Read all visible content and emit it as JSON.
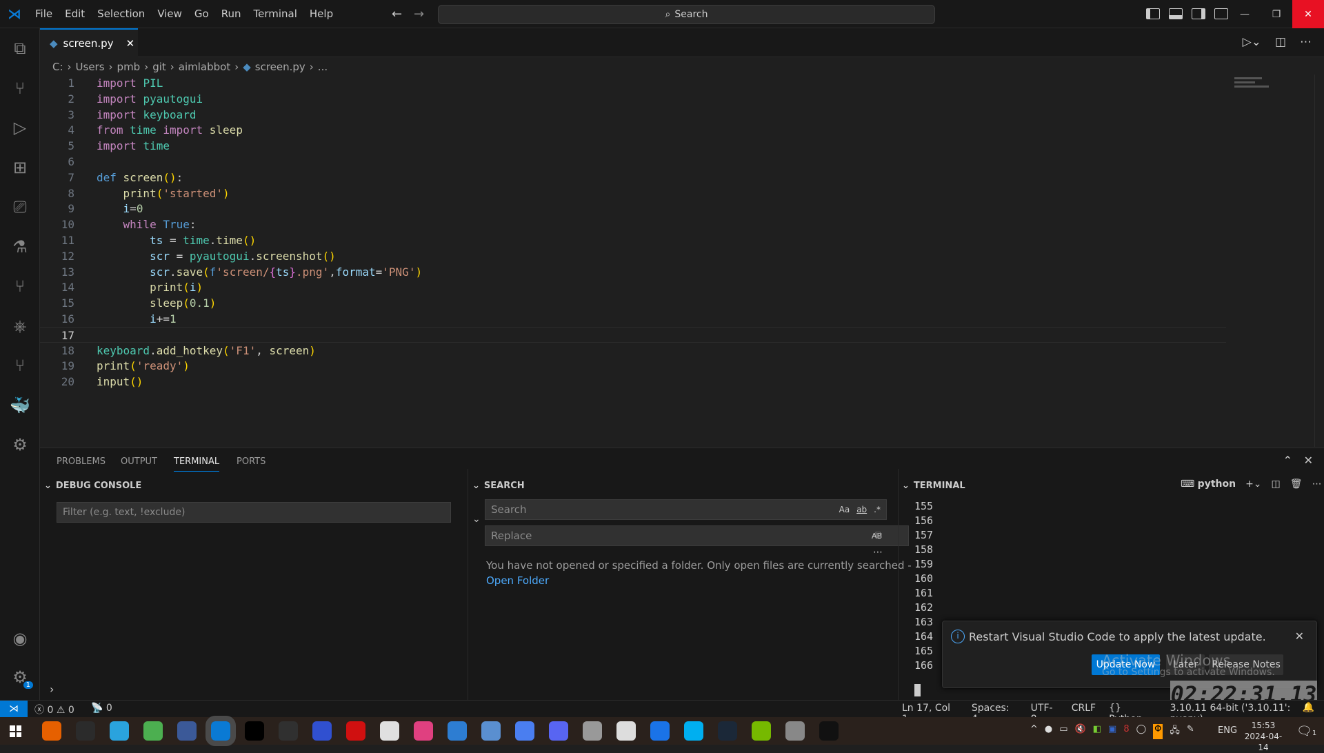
{
  "titlebar": {
    "menu": [
      "File",
      "Edit",
      "Selection",
      "View",
      "Go",
      "Run",
      "Terminal",
      "Help"
    ],
    "search_label": "Search",
    "close_color": "#e81123"
  },
  "activity_bar": [
    "files-icon",
    "source-control-icon",
    "run-debug-icon",
    "extensions-icon",
    "remote-explorer-icon",
    "testing-icon",
    "git-graph-icon",
    "kubernetes-icon",
    "gitlens-icon",
    "docker-icon",
    "python-env-icon"
  ],
  "activity_bottom": {
    "accounts": "accounts-icon",
    "manage": "gear-icon",
    "badge": "1"
  },
  "tab": {
    "label": "screen.py"
  },
  "breadcrumb": [
    "C:",
    "Users",
    "pmb",
    "git",
    "aimlabbot",
    "screen.py",
    "..."
  ],
  "editor": {
    "current_line": 17,
    "lines": [
      [
        [
          "import",
          "k"
        ],
        [
          " ",
          "t"
        ],
        [
          "PIL",
          "m"
        ]
      ],
      [
        [
          "import",
          "k"
        ],
        [
          " ",
          "t"
        ],
        [
          "pyautogui",
          "m"
        ]
      ],
      [
        [
          "import",
          "k"
        ],
        [
          " ",
          "t"
        ],
        [
          "keyboard",
          "m"
        ]
      ],
      [
        [
          "from",
          "k"
        ],
        [
          " ",
          "t"
        ],
        [
          "time",
          "m"
        ],
        [
          " ",
          "t"
        ],
        [
          "import",
          "k"
        ],
        [
          " ",
          "t"
        ],
        [
          "sleep",
          "f"
        ]
      ],
      [
        [
          "import",
          "k"
        ],
        [
          " ",
          "t"
        ],
        [
          "time",
          "m"
        ]
      ],
      [],
      [
        [
          "def",
          "d"
        ],
        [
          " ",
          "t"
        ],
        [
          "screen",
          "f"
        ],
        [
          "()",
          "b"
        ],
        [
          ":",
          "t"
        ]
      ],
      [
        [
          "    ",
          "t"
        ],
        [
          "print",
          "f"
        ],
        [
          "(",
          "b"
        ],
        [
          "'started'",
          "s"
        ],
        [
          ")",
          "b"
        ]
      ],
      [
        [
          "    ",
          "t"
        ],
        [
          "i",
          "v"
        ],
        [
          "=",
          "t"
        ],
        [
          "0",
          "n"
        ]
      ],
      [
        [
          "    ",
          "t"
        ],
        [
          "while",
          "k"
        ],
        [
          " ",
          "t"
        ],
        [
          "True",
          "d"
        ],
        [
          ":",
          "t"
        ]
      ],
      [
        [
          "        ",
          "t"
        ],
        [
          "ts",
          "v"
        ],
        [
          " = ",
          "t"
        ],
        [
          "time",
          "m"
        ],
        [
          ".",
          "t"
        ],
        [
          "time",
          "f"
        ],
        [
          "()",
          "b"
        ]
      ],
      [
        [
          "        ",
          "t"
        ],
        [
          "scr",
          "v"
        ],
        [
          " = ",
          "t"
        ],
        [
          "pyautogui",
          "m"
        ],
        [
          ".",
          "t"
        ],
        [
          "screenshot",
          "f"
        ],
        [
          "()",
          "b"
        ]
      ],
      [
        [
          "        ",
          "t"
        ],
        [
          "scr",
          "v"
        ],
        [
          ".",
          "t"
        ],
        [
          "save",
          "f"
        ],
        [
          "(",
          "b"
        ],
        [
          "f",
          "d"
        ],
        [
          "'screen/",
          "s"
        ],
        [
          "{",
          "p"
        ],
        [
          "ts",
          "v"
        ],
        [
          "}",
          "p"
        ],
        [
          ".png'",
          "s"
        ],
        [
          ",",
          "t"
        ],
        [
          "format",
          "v"
        ],
        [
          "=",
          "t"
        ],
        [
          "'PNG'",
          "s"
        ],
        [
          ")",
          "b"
        ]
      ],
      [
        [
          "        ",
          "t"
        ],
        [
          "print",
          "f"
        ],
        [
          "(",
          "b"
        ],
        [
          "i",
          "v"
        ],
        [
          ")",
          "b"
        ]
      ],
      [
        [
          "        ",
          "t"
        ],
        [
          "sleep",
          "f"
        ],
        [
          "(",
          "b"
        ],
        [
          "0.1",
          "n"
        ],
        [
          ")",
          "b"
        ]
      ],
      [
        [
          "        ",
          "t"
        ],
        [
          "i",
          "v"
        ],
        [
          "+=",
          "t"
        ],
        [
          "1",
          "n"
        ]
      ],
      [],
      [
        [
          "keyboard",
          "m"
        ],
        [
          ".",
          "t"
        ],
        [
          "add_hotkey",
          "f"
        ],
        [
          "(",
          "b"
        ],
        [
          "'F1'",
          "s"
        ],
        [
          ", ",
          "t"
        ],
        [
          "screen",
          "f"
        ],
        [
          ")",
          "b"
        ]
      ],
      [
        [
          "print",
          "f"
        ],
        [
          "(",
          "b"
        ],
        [
          "'ready'",
          "s"
        ],
        [
          ")",
          "b"
        ]
      ],
      [
        [
          "input",
          "f"
        ],
        [
          "()",
          "b"
        ]
      ]
    ]
  },
  "panel": {
    "tabs": [
      "PROBLEMS",
      "OUTPUT",
      "TERMINAL",
      "PORTS"
    ],
    "active_tab": "TERMINAL",
    "debug_console": {
      "title": "DEBUG CONSOLE",
      "filter_placeholder": "Filter (e.g. text, !exclude)"
    },
    "search": {
      "title": "SEARCH",
      "search_placeholder": "Search",
      "replace_placeholder": "Replace",
      "case_label": "Aa",
      "word_label": "ab",
      "regex_label": ".*",
      "preserve_case_label": "AB",
      "message": "You have not opened or specified a folder. Only open files are currently searched -",
      "open_folder": "Open Folder"
    },
    "terminal": {
      "title": "TERMINAL",
      "shell": "python",
      "lines": [
        "155",
        "156",
        "157",
        "158",
        "159",
        "160",
        "161",
        "162",
        "163",
        "164",
        "165",
        "166"
      ]
    }
  },
  "notification": {
    "message": "Restart Visual Studio Code to apply the latest update.",
    "update_now": "Update Now",
    "later": "Later",
    "release_notes": "Release Notes",
    "accent": "#0078d4"
  },
  "watermark": {
    "line1": "Activate Windows",
    "line2": "Go to Settings to activate Windows."
  },
  "clock_overlay": "02:22:31.13",
  "statusbar": {
    "errors": "0",
    "warnings": "0",
    "ports": "0",
    "position": "Ln 17, Col 1",
    "spaces": "Spaces: 4",
    "encoding": "UTF-8",
    "eol": "CRLF",
    "language": "Python",
    "interpreter": "3.10.11 64-bit ('3.10.11': pyenv)",
    "remote_color": "#0078d4"
  },
  "taskbar": {
    "apps": [
      [
        "firefox",
        "#e66000"
      ],
      [
        "terminal",
        "#2b2b2b"
      ],
      [
        "telegram",
        "#2aa3de"
      ],
      [
        "chrome",
        "#4caf50"
      ],
      [
        "keepass",
        "#3b5998"
      ],
      [
        "vscode",
        "#0a7ad4"
      ],
      [
        "app-black",
        "#000000"
      ],
      [
        "obs",
        "#303030"
      ],
      [
        "floppy-app",
        "#3050d0"
      ],
      [
        "red-arrow-app",
        "#d01010"
      ],
      [
        "target-app",
        "#e0e0e0"
      ],
      [
        "monitor-app",
        "#e04080"
      ],
      [
        "window-app",
        "#2d7dd2"
      ],
      [
        "sharex",
        "#5a8fd0"
      ],
      [
        "arc-app",
        "#4a7ef0"
      ],
      [
        "discord",
        "#5865f2"
      ],
      [
        "drive-app",
        "#999999"
      ],
      [
        "settings",
        "#dddddd"
      ],
      [
        "shazam",
        "#1a73e8"
      ],
      [
        "skype",
        "#00aff0"
      ],
      [
        "steam",
        "#1b2838"
      ],
      [
        "nvidia",
        "#76b900"
      ],
      [
        "python-app",
        "#888888"
      ],
      [
        "cmd",
        "#111111"
      ]
    ],
    "tray": {
      "language": "ENG",
      "time": "15:53",
      "date": "2024-04-14",
      "notifications": "1"
    }
  }
}
